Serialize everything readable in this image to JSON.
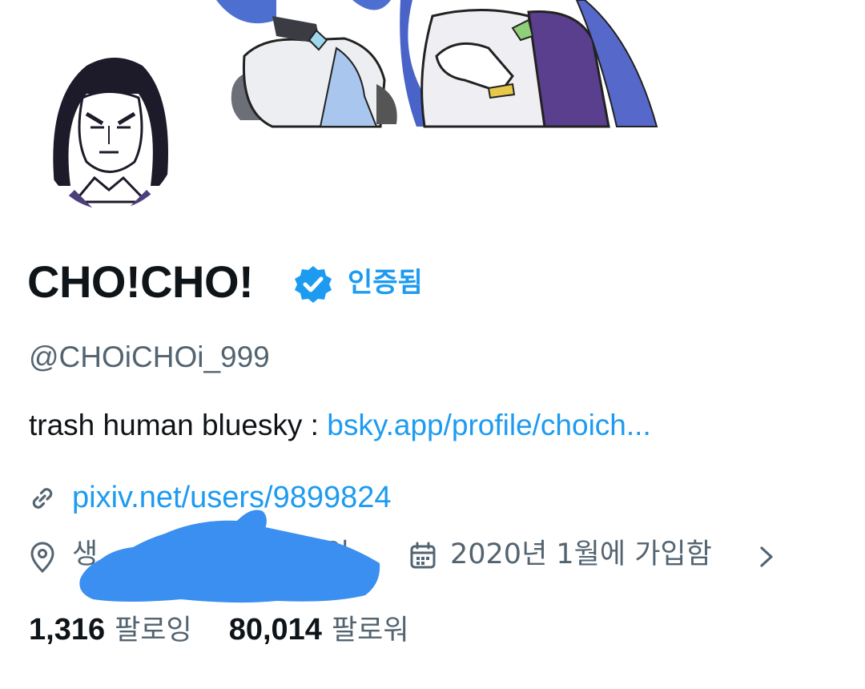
{
  "profile": {
    "display_name": "CHO!CHO!",
    "verified_label": "인증됨",
    "handle": "@CHOiCHOi_999",
    "bio_text": "trash human  bluesky : ",
    "bio_link": "bsky.app/profile/choich...",
    "website": "pixiv.net/users/9899824",
    "location_visible_start": "생",
    "location_visible_end": "9일",
    "joined": "2020년 1월에 가입함",
    "following_count": "1,316",
    "following_label": "팔로잉",
    "followers_count": "80,014",
    "followers_label": "팔로워"
  },
  "icons": {
    "verified": "verified-badge-icon",
    "link": "link-icon",
    "location": "location-pin-icon",
    "calendar": "calendar-icon",
    "chevron": "chevron-right-icon"
  },
  "colors": {
    "accent": "#1d9bf0",
    "text_primary": "#0f1419",
    "text_secondary": "#536471",
    "redaction": "#3a8ff0"
  }
}
